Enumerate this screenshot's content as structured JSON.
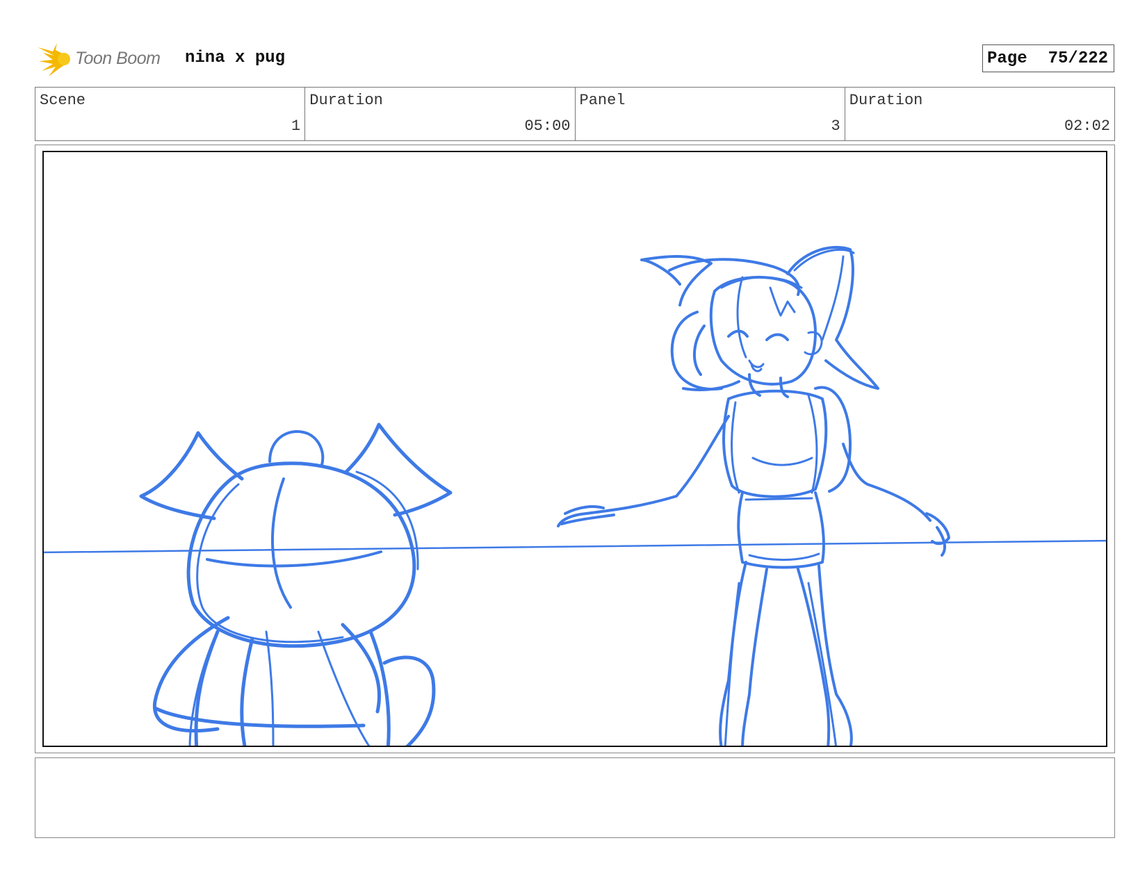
{
  "header": {
    "brand": "Toon Boom",
    "project_title": "nina x pug",
    "page_label": "Page",
    "page_number": "75/222"
  },
  "info": {
    "scene_label": "Scene",
    "scene_value": "1",
    "scene_duration_label": "Duration",
    "scene_duration_value": "05:00",
    "panel_label": "Panel",
    "panel_value": "3",
    "panel_duration_label": "Duration",
    "panel_duration_value": "02:02"
  },
  "colors": {
    "sketch_stroke": "#3e7ae6",
    "logo_accent": "#f5b800"
  },
  "notes": ""
}
